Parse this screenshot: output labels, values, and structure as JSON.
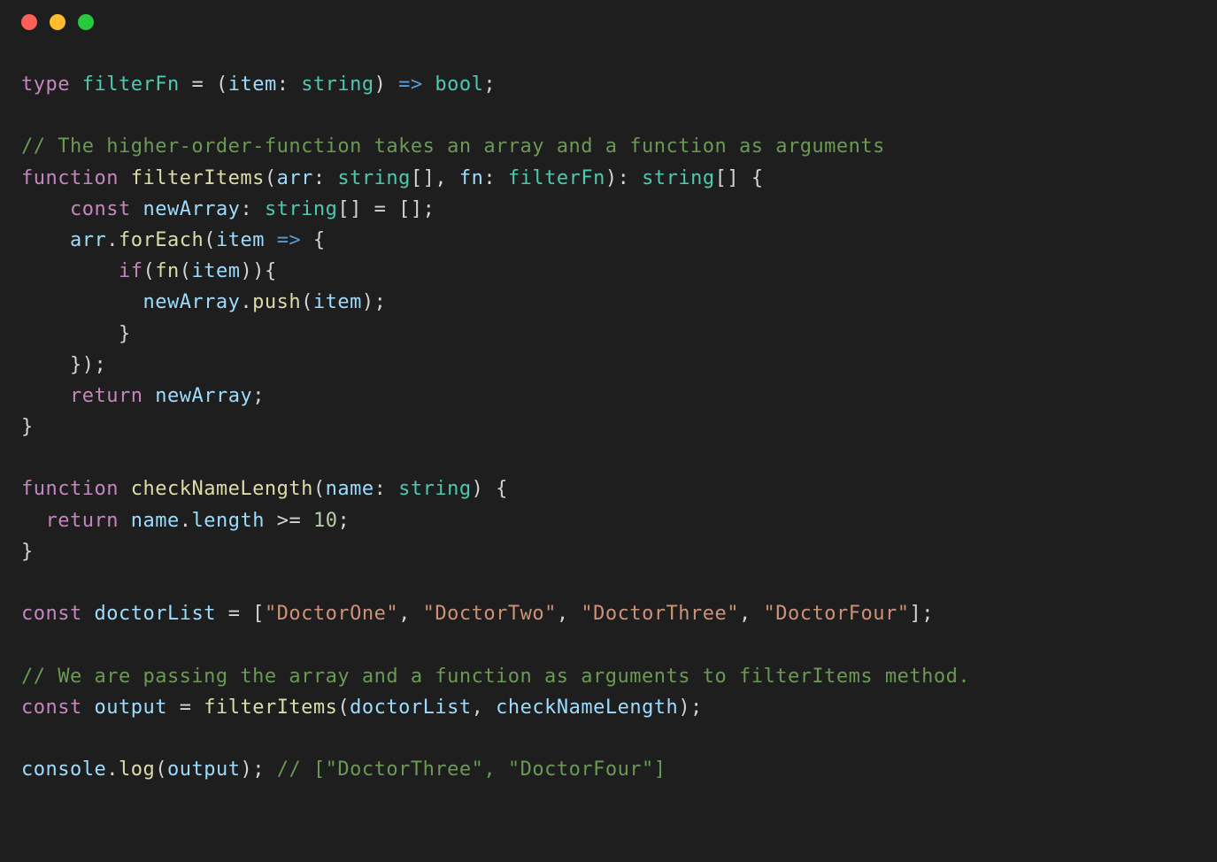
{
  "titlebar": {
    "buttons": [
      "close",
      "minimize",
      "zoom"
    ]
  },
  "code": {
    "lines": [
      {
        "kind": "code",
        "tokens": [
          [
            "kw",
            "type"
          ],
          [
            "punct",
            " "
          ],
          [
            "type",
            "filterFn"
          ],
          [
            "punct",
            " "
          ],
          [
            "op",
            "="
          ],
          [
            "punct",
            " ("
          ],
          [
            "var",
            "item"
          ],
          [
            "punct",
            ": "
          ],
          [
            "type",
            "string"
          ],
          [
            "punct",
            ") "
          ],
          [
            "arrow",
            "=>"
          ],
          [
            "punct",
            " "
          ],
          [
            "type",
            "bool"
          ],
          [
            "punct",
            ";"
          ]
        ]
      },
      {
        "kind": "blank"
      },
      {
        "kind": "code",
        "tokens": [
          [
            "comment",
            "// The higher-order-function takes an array and a function as arguments"
          ]
        ]
      },
      {
        "kind": "code",
        "tokens": [
          [
            "kw",
            "function"
          ],
          [
            "punct",
            " "
          ],
          [
            "fn",
            "filterItems"
          ],
          [
            "punct",
            "("
          ],
          [
            "var",
            "arr"
          ],
          [
            "punct",
            ": "
          ],
          [
            "type",
            "string"
          ],
          [
            "punct",
            "[], "
          ],
          [
            "var",
            "fn"
          ],
          [
            "punct",
            ": "
          ],
          [
            "type",
            "filterFn"
          ],
          [
            "punct",
            "): "
          ],
          [
            "type",
            "string"
          ],
          [
            "punct",
            "[] {"
          ]
        ]
      },
      {
        "kind": "code",
        "tokens": [
          [
            "punct",
            "    "
          ],
          [
            "kw",
            "const"
          ],
          [
            "punct",
            " "
          ],
          [
            "var",
            "newArray"
          ],
          [
            "punct",
            ": "
          ],
          [
            "type",
            "string"
          ],
          [
            "punct",
            "[] "
          ],
          [
            "op",
            "="
          ],
          [
            "punct",
            " [];"
          ]
        ]
      },
      {
        "kind": "code",
        "tokens": [
          [
            "punct",
            "    "
          ],
          [
            "var",
            "arr"
          ],
          [
            "punct",
            "."
          ],
          [
            "fn",
            "forEach"
          ],
          [
            "punct",
            "("
          ],
          [
            "var",
            "item"
          ],
          [
            "punct",
            " "
          ],
          [
            "arrow",
            "=>"
          ],
          [
            "punct",
            " {"
          ]
        ]
      },
      {
        "kind": "code",
        "tokens": [
          [
            "punct",
            "        "
          ],
          [
            "kw",
            "if"
          ],
          [
            "punct",
            "("
          ],
          [
            "fn",
            "fn"
          ],
          [
            "punct",
            "("
          ],
          [
            "var",
            "item"
          ],
          [
            "punct",
            ")){"
          ]
        ]
      },
      {
        "kind": "code",
        "tokens": [
          [
            "punct",
            "          "
          ],
          [
            "var",
            "newArray"
          ],
          [
            "punct",
            "."
          ],
          [
            "fn",
            "push"
          ],
          [
            "punct",
            "("
          ],
          [
            "var",
            "item"
          ],
          [
            "punct",
            ");"
          ]
        ]
      },
      {
        "kind": "code",
        "tokens": [
          [
            "punct",
            "        }"
          ]
        ]
      },
      {
        "kind": "code",
        "tokens": [
          [
            "punct",
            "    });"
          ]
        ]
      },
      {
        "kind": "code",
        "tokens": [
          [
            "punct",
            "    "
          ],
          [
            "kw",
            "return"
          ],
          [
            "punct",
            " "
          ],
          [
            "var",
            "newArray"
          ],
          [
            "punct",
            ";"
          ]
        ]
      },
      {
        "kind": "code",
        "tokens": [
          [
            "punct",
            "}"
          ]
        ]
      },
      {
        "kind": "blank"
      },
      {
        "kind": "code",
        "tokens": [
          [
            "kw",
            "function"
          ],
          [
            "punct",
            " "
          ],
          [
            "fn",
            "checkNameLength"
          ],
          [
            "punct",
            "("
          ],
          [
            "var",
            "name"
          ],
          [
            "punct",
            ": "
          ],
          [
            "type",
            "string"
          ],
          [
            "punct",
            ") {"
          ]
        ]
      },
      {
        "kind": "code",
        "tokens": [
          [
            "punct",
            "  "
          ],
          [
            "kw",
            "return"
          ],
          [
            "punct",
            " "
          ],
          [
            "var",
            "name"
          ],
          [
            "punct",
            "."
          ],
          [
            "var",
            "length"
          ],
          [
            "punct",
            " "
          ],
          [
            "op",
            ">="
          ],
          [
            "punct",
            " "
          ],
          [
            "num",
            "10"
          ],
          [
            "punct",
            ";"
          ]
        ]
      },
      {
        "kind": "code",
        "tokens": [
          [
            "punct",
            "}"
          ]
        ]
      },
      {
        "kind": "blank"
      },
      {
        "kind": "code",
        "tokens": [
          [
            "kw",
            "const"
          ],
          [
            "punct",
            " "
          ],
          [
            "var",
            "doctorList"
          ],
          [
            "punct",
            " "
          ],
          [
            "op",
            "="
          ],
          [
            "punct",
            " ["
          ],
          [
            "str",
            "\"DoctorOne\""
          ],
          [
            "punct",
            ", "
          ],
          [
            "str",
            "\"DoctorTwo\""
          ],
          [
            "punct",
            ", "
          ],
          [
            "str",
            "\"DoctorThree\""
          ],
          [
            "punct",
            ", "
          ],
          [
            "str",
            "\"DoctorFour\""
          ],
          [
            "punct",
            "];"
          ]
        ]
      },
      {
        "kind": "blank"
      },
      {
        "kind": "code",
        "tokens": [
          [
            "comment",
            "// We are passing the array and a function as arguments to filterItems method."
          ]
        ]
      },
      {
        "kind": "code",
        "tokens": [
          [
            "kw",
            "const"
          ],
          [
            "punct",
            " "
          ],
          [
            "var",
            "output"
          ],
          [
            "punct",
            " "
          ],
          [
            "op",
            "="
          ],
          [
            "punct",
            " "
          ],
          [
            "fn",
            "filterItems"
          ],
          [
            "punct",
            "("
          ],
          [
            "var",
            "doctorList"
          ],
          [
            "punct",
            ", "
          ],
          [
            "var",
            "checkNameLength"
          ],
          [
            "punct",
            ");"
          ]
        ]
      },
      {
        "kind": "blank"
      },
      {
        "kind": "code",
        "tokens": [
          [
            "var",
            "console"
          ],
          [
            "punct",
            "."
          ],
          [
            "fn",
            "log"
          ],
          [
            "punct",
            "("
          ],
          [
            "var",
            "output"
          ],
          [
            "punct",
            "); "
          ],
          [
            "comment",
            "// [\"DoctorThree\", \"DoctorFour\"]"
          ]
        ]
      }
    ]
  }
}
